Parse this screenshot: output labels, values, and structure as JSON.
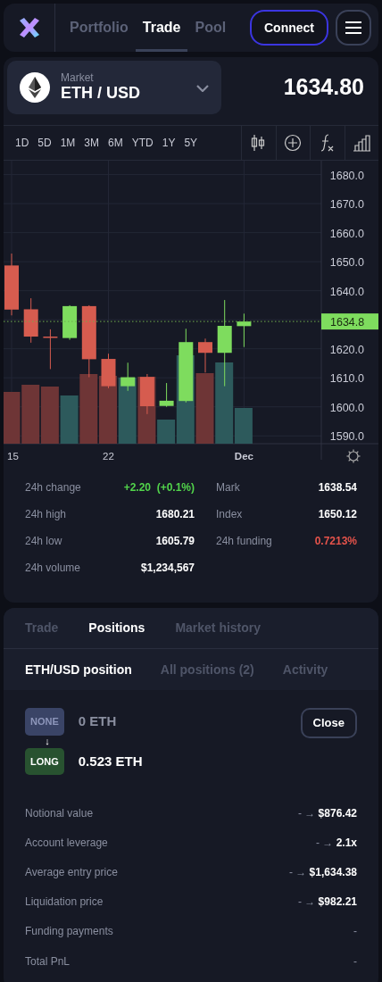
{
  "header": {
    "nav": [
      {
        "label": "Portfolio",
        "selected": false
      },
      {
        "label": "Trade",
        "selected": true
      },
      {
        "label": "Pool",
        "selected": false
      }
    ],
    "connect": "Connect"
  },
  "market": {
    "label": "Market",
    "pair": "ETH / USD",
    "price": "1634.80"
  },
  "timeframes": [
    "1D",
    "5D",
    "1M",
    "3M",
    "6M",
    "YTD",
    "1Y",
    "5Y"
  ],
  "chart": {
    "price_labels": [
      "1680.0",
      "1670.0",
      "1660.0",
      "1650.0",
      "1640.0",
      "1620.0",
      "1610.0",
      "1600.0",
      "1590.0"
    ],
    "current_price": "1634.8",
    "date_labels": [
      "15",
      "22",
      "Dec"
    ]
  },
  "stats": {
    "left": [
      {
        "label": "24h change",
        "value": "+2.20  (+0.1%)",
        "color": "#52d44b"
      },
      {
        "label": "24h high",
        "value": "1680.21"
      },
      {
        "label": "24h low",
        "value": "1605.79"
      },
      {
        "label": "24h volume",
        "value": "$1,234,567"
      }
    ],
    "right": [
      {
        "label": "Mark",
        "value": "1638.54"
      },
      {
        "label": "Index",
        "value": "1650.12"
      },
      {
        "label": "24h funding",
        "value": "0.7213%",
        "color": "#e5534b"
      }
    ]
  },
  "tabs": [
    {
      "label": "Trade",
      "selected": false
    },
    {
      "label": "Positions",
      "selected": true
    },
    {
      "label": "Market history",
      "selected": false
    }
  ],
  "subtabs": [
    {
      "label": "ETH/USD position",
      "selected": true
    },
    {
      "label": "All positions (2)",
      "selected": false
    },
    {
      "label": "Activity",
      "selected": false
    }
  ],
  "position": {
    "from": {
      "kind": "none",
      "badge": "NONE",
      "amount": "0 ETH"
    },
    "arrow": "↓",
    "to": {
      "kind": "long",
      "badge": "LONG",
      "amount": "0.523 ETH"
    },
    "close": "Close",
    "details": [
      {
        "label": "Notional value",
        "from": "-",
        "arrow": "→",
        "to": "$876.42"
      },
      {
        "label": "Account leverage",
        "from": "-",
        "arrow": "→",
        "to": "2.1x"
      },
      {
        "label": "Average entry price",
        "from": "-",
        "arrow": "→",
        "to": "$1,634.38"
      },
      {
        "label": "Liquidation price",
        "from": "-",
        "arrow": "→",
        "to": "$982.21"
      },
      {
        "label": "Funding payments",
        "value": "-"
      },
      {
        "label": "Total PnL",
        "value": "-"
      }
    ]
  }
}
